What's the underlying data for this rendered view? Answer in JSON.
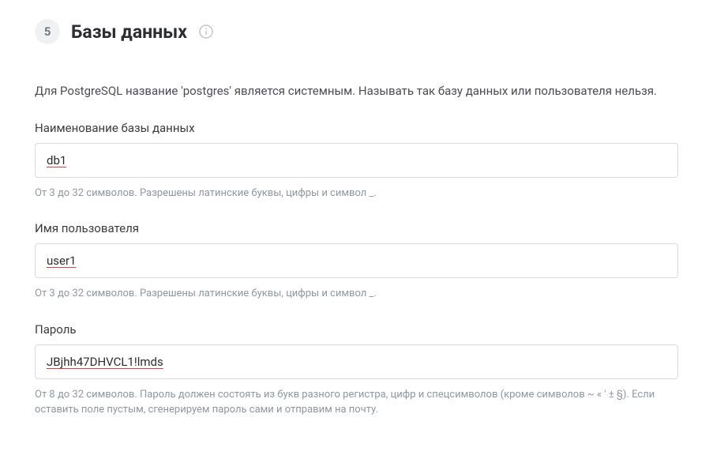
{
  "section": {
    "step": "5",
    "title": "Базы данных",
    "description": "Для PostgreSQL название 'postgres' является системным. Называть так базу данных или пользователя нельзя."
  },
  "fields": {
    "dbname": {
      "label": "Наименование базы данных",
      "value": "db1",
      "help": "От 3 до 32 символов. Разрешены латинские буквы, цифры и символ _."
    },
    "username": {
      "label": "Имя пользователя",
      "value": "user1",
      "help": "От 3 до 32 символов. Разрешены латинские буквы, цифры и символ _."
    },
    "password": {
      "label": "Пароль",
      "value": "JBjhh47DHVCL1!lmds",
      "help": "От 8 до 32 символов. Пароль должен состоять из букв разного регистра, цифр и спецсимволов (кроме символов ~ « ' ± §). Если оставить поле пустым, сгенерируем пароль сами и отправим на почту."
    }
  }
}
